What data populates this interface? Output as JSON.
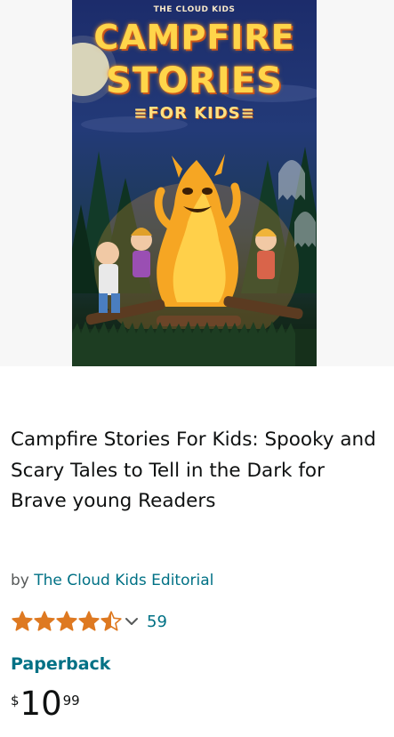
{
  "cover": {
    "publisher": "THE CLOUD KIDS",
    "title_line1": "CAMPFIRE",
    "title_line2": "STORIES",
    "subtitle": "≡FOR KIDS≡"
  },
  "product": {
    "title": "Campfire Stories For Kids: Spooky and Scary Tales to Tell in the Dark for Brave young Readers",
    "by_label": "by",
    "author": "The Cloud Kids Editorial",
    "rating": 4.5,
    "rating_icon": "star-icon",
    "review_count": "59",
    "format": "Paperback",
    "price": {
      "symbol": "$",
      "whole": "10",
      "fraction": "99"
    }
  },
  "colors": {
    "link": "#007185",
    "text": "#0f1111",
    "secondary_text": "#565959",
    "star": "#de7921"
  }
}
